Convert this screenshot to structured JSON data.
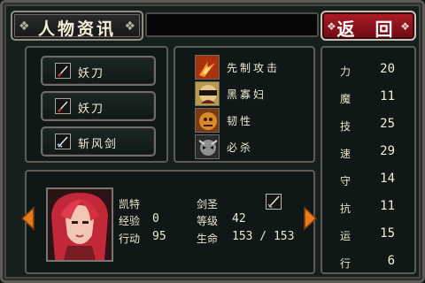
{
  "header": {
    "title": "人物资讯",
    "back_label": "返 回"
  },
  "weapons": [
    {
      "name": "妖刀",
      "icon": "sword-icon"
    },
    {
      "name": "妖刀",
      "icon": "sword-icon"
    },
    {
      "name": "斩风剑",
      "icon": "wind-sword-icon"
    }
  ],
  "skills": [
    {
      "name": "先制攻击",
      "icon": "preemptive-strike-icon"
    },
    {
      "name": "黑寡妇",
      "icon": "black-widow-icon"
    },
    {
      "name": "韧性",
      "icon": "toughness-icon"
    },
    {
      "name": "必杀",
      "icon": "critical-strike-icon"
    }
  ],
  "stats": [
    {
      "label": "力",
      "value": "20"
    },
    {
      "label": "魔",
      "value": "11"
    },
    {
      "label": "技",
      "value": "25"
    },
    {
      "label": "速",
      "value": "29"
    },
    {
      "label": "守",
      "value": "14"
    },
    {
      "label": "抗",
      "value": "11"
    },
    {
      "label": "运",
      "value": "15"
    },
    {
      "label": "行",
      "value": "6"
    }
  ],
  "character": {
    "name": "凯特",
    "class": "剑圣",
    "exp_label": "经验",
    "exp": "0",
    "level_label": "等级",
    "level": "42",
    "move_label": "行动",
    "move": "95",
    "hp_label": "生命",
    "hp": "153 / 153"
  },
  "colors": {
    "accent_red": "#b01d28",
    "frame": "#5c5a55",
    "panel": "#0f1816"
  }
}
